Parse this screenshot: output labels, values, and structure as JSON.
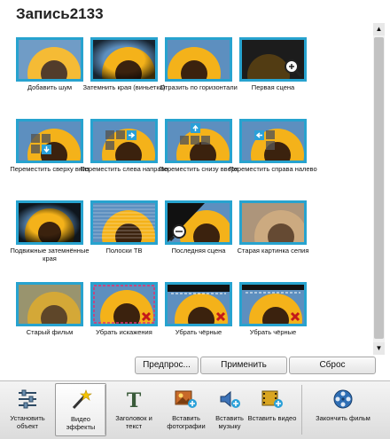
{
  "title": "Запись2133",
  "effects": [
    {
      "label": "Добавить шум"
    },
    {
      "label": "Затемнить края (виньетка)"
    },
    {
      "label": "Отразить по горизонтали"
    },
    {
      "label": "Первая сцена"
    },
    {
      "label": "Переместить сверху вниз"
    },
    {
      "label": "Переместить слева направо"
    },
    {
      "label": "Переместить снизу вверх"
    },
    {
      "label": "Переместить справа налево"
    },
    {
      "label": "Подвижные затемнённые края"
    },
    {
      "label": "Полоски ТВ"
    },
    {
      "label": "Последняя сцена"
    },
    {
      "label": "Старая картинка сепия"
    },
    {
      "label": "Старый фильм"
    },
    {
      "label": "Убрать искажения"
    },
    {
      "label": "Убрать чёрные"
    },
    {
      "label": "Убрать чёрные"
    }
  ],
  "buttons": {
    "preview": "Предпрос...",
    "apply": "Применить",
    "reset": "Сброс"
  },
  "toolbar": {
    "set_object": "Установить объект",
    "video_effects": "Видео эффекты",
    "title_text": "Заголовок и текст",
    "insert_photos": "Вставить фотографии",
    "insert_music": "Вставить музыку",
    "insert_video": "Вставить видео",
    "finish_movie": "Закончить фильм"
  },
  "colors": {
    "accent": "#27a3cf",
    "sky": "#5d8fbf",
    "petal": "#f4b21a",
    "center": "#3b220e"
  }
}
